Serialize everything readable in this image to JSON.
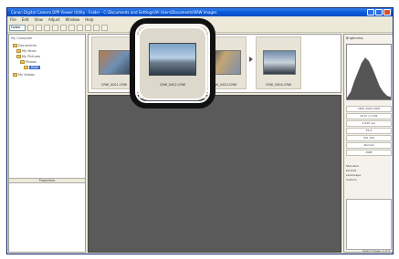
{
  "window": {
    "title": "Canon Digital Camera DPP Viewer Utility - Folder - C:\\Documents and Settings\\All Users\\Documents\\RAW Images"
  },
  "menu": [
    "File",
    "Edit",
    "View",
    "Adjust",
    "Window",
    "Help"
  ],
  "toolbar": {
    "folder_select": "Folder"
  },
  "tree": {
    "header": "My Computer",
    "items": [
      {
        "label": "Documents"
      },
      {
        "label": "My Music"
      },
      {
        "label": "My Pictures"
      },
      {
        "label": "Photos"
      },
      {
        "label": "RAW"
      },
      {
        "label": "My Videos"
      }
    ],
    "bottom_label": "Properties"
  },
  "thumbnails": [
    {
      "caption": "CRW_0001.CRW"
    },
    {
      "caption": "CRW_0002.CRW"
    },
    {
      "caption": "CRW_0003.CRW"
    },
    {
      "caption": "CRW_0004.CRW"
    }
  ],
  "right_panel": {
    "title": "Brightness",
    "info": [
      "CRW_0002.CRW",
      "2272 x 1704",
      "1/125 sec",
      "F5.6",
      "ISO 100",
      "Normal",
      "AWB"
    ],
    "options": [
      "Standard",
      "Portrait",
      "Landscape",
      "Custom"
    ]
  },
  "status": {
    "text": "Select image: 1 of 4"
  },
  "colors": {
    "titlebar": "#0b5ddd",
    "preview_bg": "#5a5a5a",
    "highlight": "#111111"
  }
}
